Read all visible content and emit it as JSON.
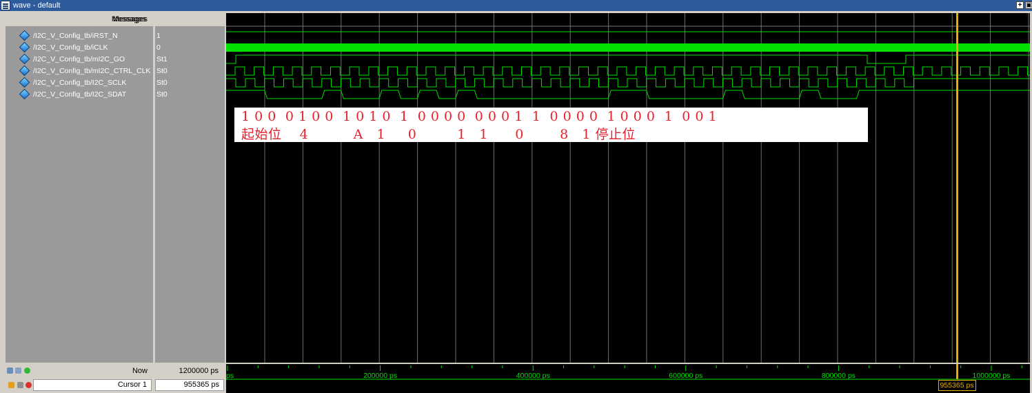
{
  "window": {
    "title": "wave - default",
    "buttons": [
      "+",
      "▣"
    ]
  },
  "headers": {
    "messages": "Messages"
  },
  "signals": [
    {
      "name": "/I2C_V_Config_tb/iRST_N",
      "value": "1"
    },
    {
      "name": "/I2C_V_Config_tb/iCLK",
      "value": "0"
    },
    {
      "name": "/I2C_V_Config_tb/mI2C_GO",
      "value": "St1"
    },
    {
      "name": "/I2C_V_Config_tb/mI2C_CTRL_CLK",
      "value": "St0"
    },
    {
      "name": "/I2C_V_Config_tb/I2C_SCLK",
      "value": "St0"
    },
    {
      "name": "/I2C_V_Config_tb/I2C_SDAT",
      "value": "St0"
    }
  ],
  "annotation": {
    "bits_line": "1 0 0  0 1 0 0  1 0 1 0  1  0 0 0 0  0 0 0 1  1  0 0 0 0  1 0 0 0  1  0 0 1",
    "label_line": "起始位    4          A   1     0         1   1      0        8   1 停止位"
  },
  "status": {
    "now_label": "Now",
    "now_value": "1200000 ps",
    "cursor_label": "Cursor 1",
    "cursor_value": "955365 ps",
    "cursor_tag": "955365 ps"
  },
  "timeline": {
    "range_ps": [
      0,
      1200000
    ],
    "cursor_ps": 955365,
    "tick_labels": [
      "ps",
      "200000 ps",
      "400000 ps",
      "600000 ps",
      "800000 ps",
      "1000000 ps"
    ],
    "tick_values_ps": [
      0,
      200000,
      400000,
      600000,
      800000,
      1000000
    ]
  },
  "colors": {
    "wave": "#00e000",
    "grid": "#6f6f6f",
    "cursor": "#e8b000",
    "annotation_text": "#e8202c",
    "timeline_text": "#00e000"
  }
}
